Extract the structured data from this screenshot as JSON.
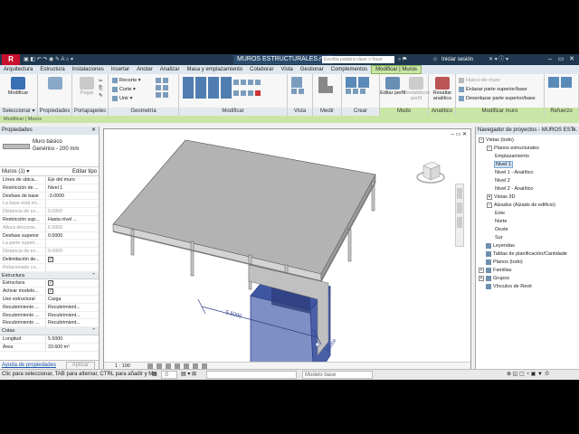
{
  "title": {
    "document": "MUROS ESTRUCTURALES.rv...",
    "search_placeholder": "Escriba palabra clave o frase",
    "login": "Iniciar sesión",
    "logo": "R"
  },
  "tabs": [
    "Arquitectura",
    "Estructura",
    "Instalaciones",
    "Insertar",
    "Anotar",
    "Analizar",
    "Masa y emplazamiento",
    "Colaborar",
    "Vista",
    "Gestionar",
    "Complementos",
    "Modificar | Muros"
  ],
  "ribbon": {
    "seleccionar": {
      "btn": "Modificar",
      "label": "Seleccionar ▾"
    },
    "propiedades": {
      "label": "Propiedades"
    },
    "portapapeles": {
      "btn": "Pegar",
      "label": "Portapapeles"
    },
    "geometria": {
      "items": [
        "Recorte ▾",
        "Corte ▾",
        "Unir ▾"
      ],
      "label": "Geometría"
    },
    "modificar": {
      "label": "Modificar"
    },
    "vista": {
      "label": "Vista"
    },
    "medir": {
      "label": "Medir"
    },
    "crear": {
      "label": "Crear"
    },
    "modo": {
      "btn1": "Editar perfil",
      "btn2": "Restablecer perfil",
      "label": "Modo"
    },
    "analitico": {
      "btn": "Resaltar analítico",
      "label": "Analítico"
    },
    "modificar_muro": {
      "items": [
        "Hueco de muro",
        "Enlazar parte superior/base",
        "Desenlazar parte superior/base"
      ],
      "label": "Modificar muro"
    },
    "refuerzo": {
      "label": "Refuerzo"
    }
  },
  "options_bar": "Modificar | Muros",
  "properties": {
    "header": "Propiedades",
    "type_name": "Muro básico",
    "type_sub": "Genérico - 200 mm",
    "filter": "Muros (1)",
    "edit_type": "Editar tipo",
    "rows": [
      {
        "k": "Línea de ubica...",
        "v": "Eje del muro",
        "dim": false
      },
      {
        "k": "Restricción de ...",
        "v": "Nivel 1",
        "dim": false
      },
      {
        "k": "Desfase de base",
        "v": "-3.0000",
        "dim": false
      },
      {
        "k": "La base está en...",
        "v": "",
        "dim": true
      },
      {
        "k": "Distancia de ex...",
        "v": "0.0000",
        "dim": true
      },
      {
        "k": "Restricción sup...",
        "v": "Hasta nivel ...",
        "dim": false
      },
      {
        "k": "Altura descone...",
        "v": "6.0000",
        "dim": true
      },
      {
        "k": "Desfase superior",
        "v": "0.0000",
        "dim": false
      },
      {
        "k": "La parte superi...",
        "v": "",
        "dim": true
      },
      {
        "k": "Distancia de ex...",
        "v": "0.0000",
        "dim": true
      },
      {
        "k": "Delimitación de...",
        "v": "✓",
        "dim": false
      },
      {
        "k": "Relacionado co...",
        "v": "",
        "dim": true
      }
    ],
    "section_structure": "Estructura",
    "rows2": [
      {
        "k": "Estructura",
        "v": "✓"
      },
      {
        "k": "Activar modelo...",
        "v": "✓"
      },
      {
        "k": "Uso estructural",
        "v": "Carga"
      },
      {
        "k": "Recubrimiento ...",
        "v": "Recubrimient..."
      },
      {
        "k": "Recubrimiento ...",
        "v": "Recubrimient..."
      },
      {
        "k": "Recubrimiento ...",
        "v": "Recubrimient..."
      }
    ],
    "section_cotas": "Cotas",
    "rows3": [
      {
        "k": "Longitud",
        "v": "5.5000"
      },
      {
        "k": "Área",
        "v": "33.600 m²"
      }
    ],
    "help": "Ayuda de propiedades",
    "apply": "Aplicar"
  },
  "viewport": {
    "dimension_label": "5.5000",
    "dimension_label2": "0.2000",
    "cube_label": "FRONT"
  },
  "view_bar": {
    "scale": "1 : 100"
  },
  "project_browser": {
    "header": "Navegador de proyectos - MUROS EST...",
    "tree": [
      {
        "label": "Vistas (todo)",
        "level": 0,
        "toggle": "−",
        "icon": false
      },
      {
        "label": "Planos estructurales",
        "level": 1,
        "toggle": "−",
        "icon": false
      },
      {
        "label": "Emplazamiento",
        "level": 2,
        "toggle": "",
        "icon": false
      },
      {
        "label": "Nivel 1",
        "level": 2,
        "toggle": "",
        "icon": false,
        "selected": true
      },
      {
        "label": "Nivel 1 - Analítico",
        "level": 2,
        "toggle": "",
        "icon": false
      },
      {
        "label": "Nivel 2",
        "level": 2,
        "toggle": "",
        "icon": false
      },
      {
        "label": "Nivel 2 - Analítico",
        "level": 2,
        "toggle": "",
        "icon": false
      },
      {
        "label": "Vistas 3D",
        "level": 1,
        "toggle": "+",
        "icon": false
      },
      {
        "label": "Alzados (Alzado de edificio)",
        "level": 1,
        "toggle": "−",
        "icon": false
      },
      {
        "label": "Este",
        "level": 2,
        "toggle": "",
        "icon": false
      },
      {
        "label": "Norte",
        "level": 2,
        "toggle": "",
        "icon": false
      },
      {
        "label": "Oeste",
        "level": 2,
        "toggle": "",
        "icon": false
      },
      {
        "label": "Sur",
        "level": 2,
        "toggle": "",
        "icon": false
      },
      {
        "label": "Leyendas",
        "level": 0,
        "toggle": "",
        "icon": true
      },
      {
        "label": "Tablas de planificación/Cantidade",
        "level": 0,
        "toggle": "",
        "icon": true
      },
      {
        "label": "Planos (todo)",
        "level": 0,
        "toggle": "",
        "icon": true
      },
      {
        "label": "Familias",
        "level": 0,
        "toggle": "+",
        "icon": true
      },
      {
        "label": "Grupos",
        "level": 0,
        "toggle": "+",
        "icon": true
      },
      {
        "label": "Vínculos de Revit",
        "level": 0,
        "toggle": "",
        "icon": true
      }
    ]
  },
  "status": {
    "text": "Clic para seleccionar, TAB para alternar, CTRL para añadir y M",
    "zero": ":0",
    "model": "Modelo base"
  }
}
